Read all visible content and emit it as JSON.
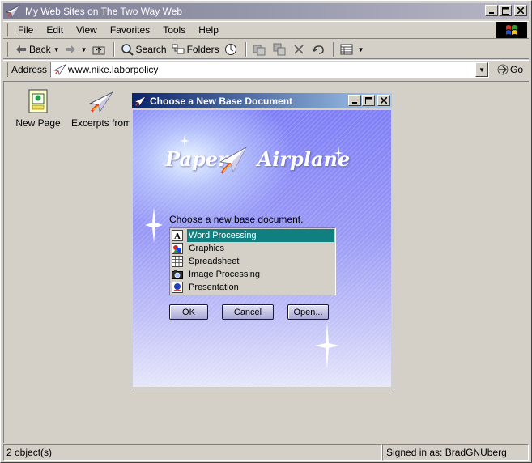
{
  "window": {
    "title": "My Web Sites on The Two Way Web"
  },
  "menu": [
    "File",
    "Edit",
    "View",
    "Favorites",
    "Tools",
    "Help"
  ],
  "toolbar": {
    "back_label": "Back",
    "search_label": "Search",
    "folders_label": "Folders"
  },
  "address": {
    "label": "Address",
    "value": "www.nike.laborpolicy",
    "go_label": "Go"
  },
  "content": {
    "icons": [
      {
        "label": "New Page",
        "icon": "new-page-icon"
      },
      {
        "label": "Excerpts from",
        "icon": "paper-airplane-icon"
      }
    ]
  },
  "status": {
    "objects": "2 object(s)",
    "signed_in": "Signed in as: BradGNUberg"
  },
  "dialog": {
    "title": "Choose a New Base Document",
    "logo_left": "Paper",
    "logo_right": "Airplane",
    "prompt": "Choose a new base document.",
    "items": [
      {
        "label": "Word Processing",
        "icon": "word-processing-icon",
        "selected": true
      },
      {
        "label": "Graphics",
        "icon": "graphics-icon",
        "selected": false
      },
      {
        "label": "Spreadsheet",
        "icon": "spreadsheet-icon",
        "selected": false
      },
      {
        "label": "Image Processing",
        "icon": "camera-icon",
        "selected": false
      },
      {
        "label": "Presentation",
        "icon": "presentation-icon",
        "selected": false
      }
    ],
    "ok_label": "OK",
    "cancel_label": "Cancel",
    "open_label": "Open..."
  },
  "colors": {
    "selection": "#0f7f7f",
    "dialog_title": "#0a246a",
    "window_title_inactive": "#7b7b93"
  }
}
